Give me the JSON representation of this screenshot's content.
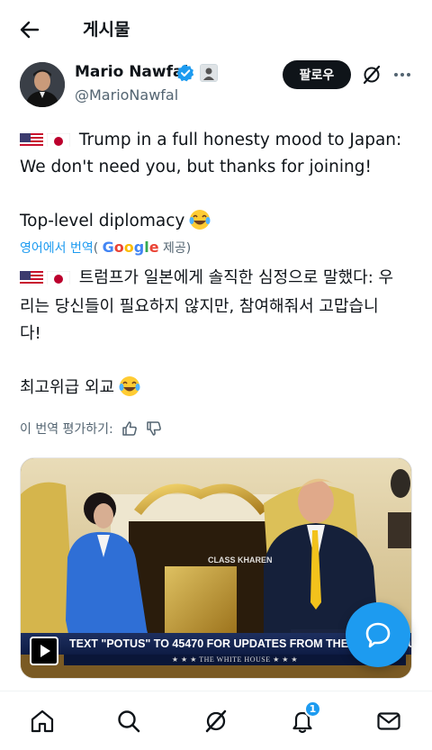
{
  "header": {
    "title": "게시물",
    "back_icon": "back-arrow-icon"
  },
  "author": {
    "name": "Mario Nawfal",
    "handle": "@MarioNawfal",
    "verified": true,
    "verified_color": "#1d9bf0"
  },
  "follow_label": "팔로우",
  "tweet": {
    "line1": "Trump in a full honesty mood to Japan:",
    "line2": "We don't need you, but thanks for joining!",
    "line3": "Top-level diplomacy",
    "flags": [
      "us-flag",
      "japan-flag"
    ],
    "emoji": "laughing-tears-emoji"
  },
  "translation": {
    "link": "영어에서 번역",
    "paren_open": "(",
    "google": "Google",
    "provided": "제공)",
    "line1": "트럼프가 일본에게 솔직한 심정으로 말했다: 우",
    "line2": "리는 당신들이 필요하지 않지만, 참여해줘서 고맙습니",
    "line3": "다!",
    "line4": "최고위급 외교"
  },
  "rate_label": "이 번역 평가하기:",
  "media": {
    "ticker": "TEXT \"POTUS\" TO 45470 FOR UPDATES FROM THE WHITE HOUSE",
    "bar": "★ ★ ★   THE WHITE HOUSE   ★ ★ ★",
    "bug": "CLASS KHAREN"
  },
  "nav": {
    "items": [
      "home-icon",
      "search-icon",
      "grok-icon",
      "notifications-icon",
      "messages-icon"
    ],
    "notification_count": "1"
  },
  "colors": {
    "accent": "#1d9bf0",
    "text": "#0f1419",
    "muted": "#536471"
  }
}
